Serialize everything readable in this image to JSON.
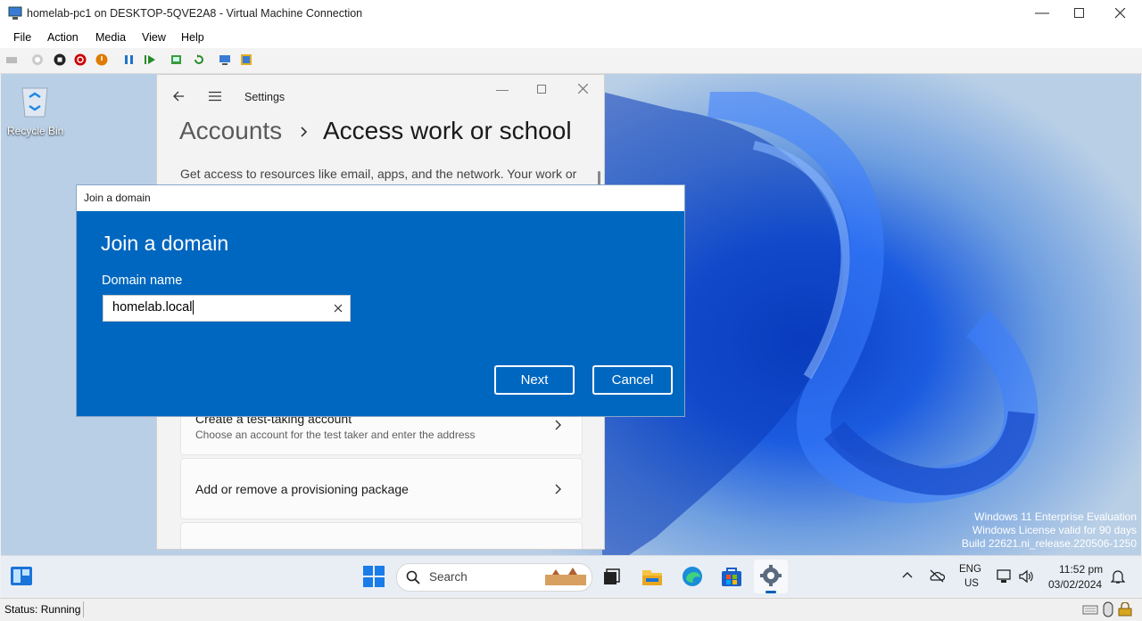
{
  "window": {
    "title": "homelab-pc1 on DESKTOP-5QVE2A8 - Virtual Machine Connection"
  },
  "menu": [
    "File",
    "Action",
    "Media",
    "View",
    "Help"
  ],
  "status": "Status: Running",
  "desktop": {
    "recycle_bin": "Recycle Bin"
  },
  "settings": {
    "app_title": "Settings",
    "breadcrumb_parent": "Accounts",
    "breadcrumb_current": "Access work or school",
    "description": "Get access to resources like email, apps, and the network. Your work or",
    "items": [
      {
        "title": "Create a test-taking account",
        "subtitle": "Choose an account for the test taker and enter the address"
      },
      {
        "title": "Add or remove a provisioning package",
        "subtitle": ""
      }
    ]
  },
  "dialog": {
    "window_title": "Join a domain",
    "heading": "Join a domain",
    "field_label": "Domain name",
    "field_value": "homelab.local",
    "next_label": "Next",
    "cancel_label": "Cancel"
  },
  "watermark": {
    "line1": "Windows 11 Enterprise Evaluation",
    "line2": "Windows License valid for 90 days",
    "line3": "Build 22621.ni_release.220506-1250"
  },
  "taskbar": {
    "search_placeholder": "Search",
    "lang1": "ENG",
    "lang2": "US",
    "time": "11:52 pm",
    "date": "03/02/2024"
  },
  "colors": {
    "dialog_blue": "#0067c0",
    "accent": "#005fb8"
  }
}
